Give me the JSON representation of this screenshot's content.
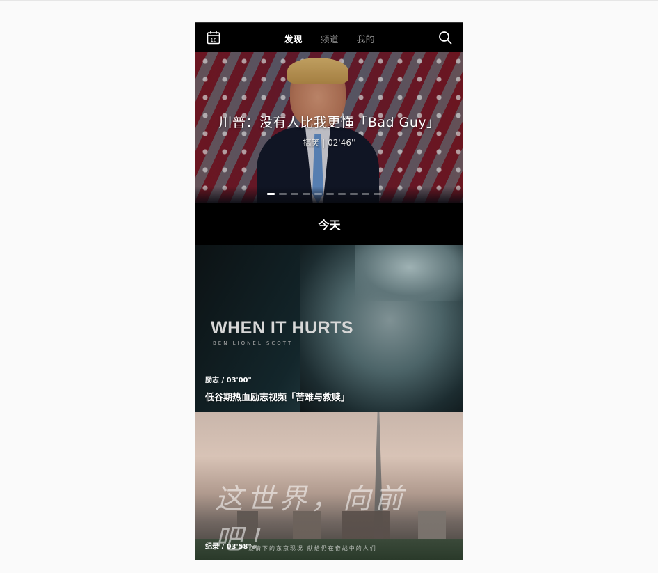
{
  "header": {
    "calendar_icon": "calendar-icon",
    "calendar_day": "18",
    "tabs": [
      {
        "label": "发现",
        "active": true
      },
      {
        "label": "频道",
        "active": false
      },
      {
        "label": "我的",
        "active": false
      }
    ],
    "search_icon": "search-icon"
  },
  "hero": {
    "title": "川普：没有人比我更懂「Bad Guy」",
    "subtitle": "搞笑 | 02'46''",
    "slide_count": 10,
    "active_slide": 1
  },
  "section": {
    "title": "今天"
  },
  "cards": [
    {
      "poster_text": "WHEN IT HURTS",
      "poster_credit": "BEN LIONEL SCOTT",
      "meta": "励志 / 03'00\"",
      "title": "低谷期热血励志视频「苦难与救赎」"
    },
    {
      "poster_text": "这世界，向前吧！",
      "poster_subtitle": "疫情下的东京现况|献给仍在奋战中的人们",
      "meta": "纪录 / 03'58\""
    }
  ],
  "colors": {
    "background": "#fafafa",
    "app_bg": "#000000",
    "active_tab": "#ffffff",
    "inactive_tab": "#8a8a8a"
  }
}
